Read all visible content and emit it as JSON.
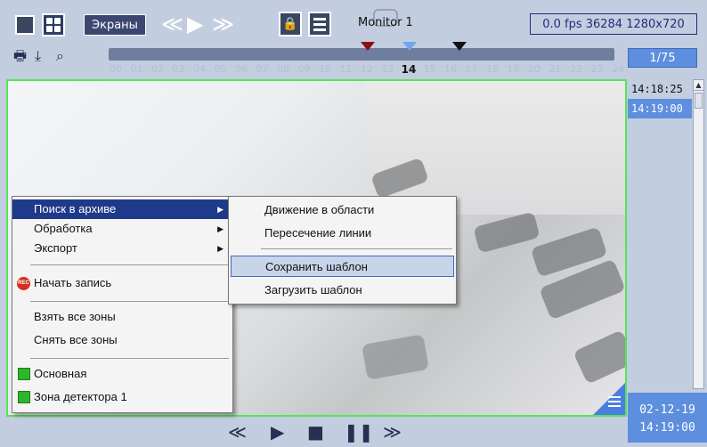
{
  "toolbar": {
    "screens_label": "Экраны",
    "monitor_label": "Monitor 1",
    "status_text": "0.0 fps  36284 1280x720"
  },
  "timeline": {
    "hours": [
      "00",
      "01",
      "02",
      "03",
      "04",
      "05",
      "06",
      "07",
      "08",
      "09",
      "10",
      "11",
      "12",
      "13",
      "14",
      "15",
      "16",
      "17",
      "18",
      "19",
      "20",
      "21",
      "22",
      "23",
      "24"
    ],
    "current_hour": "14",
    "page_counter": "1/75"
  },
  "time_list": {
    "items": [
      "14:18:25",
      "14:19:00"
    ],
    "selected_index": 1
  },
  "date_display": {
    "date": "02-12-19",
    "time": "14:19:00"
  },
  "context_menu": {
    "items": [
      {
        "label": "Поиск в архиве",
        "submenu": true
      },
      {
        "label": "Обработка",
        "submenu": true
      },
      {
        "label": "Экспорт",
        "submenu": true
      },
      {
        "label": "Начать запись",
        "icon": "rec-icon"
      },
      {
        "label": "Взять все зоны"
      },
      {
        "label": "Снять все зоны"
      },
      {
        "label": "Основная",
        "icon": "zone-icon"
      },
      {
        "label": "Зона детектора 1",
        "icon": "zone-icon"
      }
    ],
    "highlighted": "Поиск в архиве"
  },
  "submenu": {
    "items": [
      "Движение в области",
      "Пересечение линии",
      "Сохранить шаблон",
      "Загрузить шаблон"
    ],
    "highlighted": "Сохранить шаблон"
  },
  "colors": {
    "accent": "#5d8fde",
    "menu_highlight": "#1f3a8a",
    "camera_border": "#55e455"
  }
}
